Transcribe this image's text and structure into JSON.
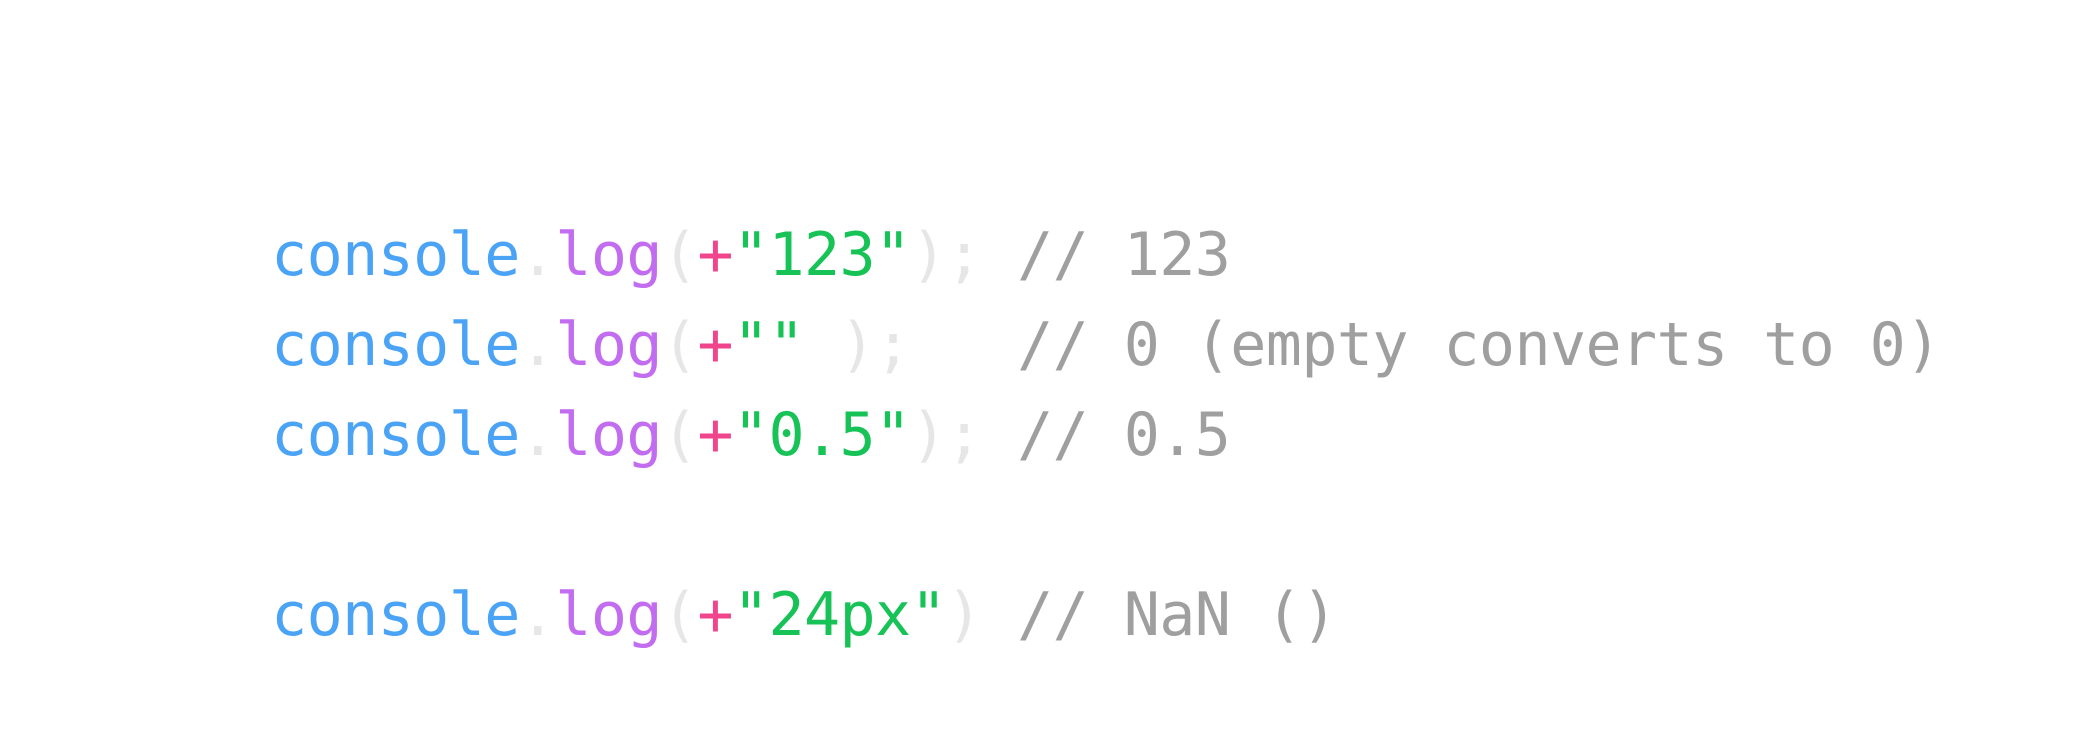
{
  "theme": {
    "background": "#ffffff",
    "object_color": "#4aa3f5",
    "method_color": "#c26cf0",
    "operator_color": "#f0458c",
    "string_color": "#17c257",
    "punctuation_color": "#e6e6e6",
    "comment_color": "#9f9f9f"
  },
  "lines": [
    {
      "tokens": [
        {
          "text": "console",
          "kind": "object"
        },
        {
          "text": ".",
          "kind": "punctuation"
        },
        {
          "text": "log",
          "kind": "method"
        },
        {
          "text": "(",
          "kind": "punctuation"
        },
        {
          "text": "+",
          "kind": "operator"
        },
        {
          "text": "\"123\"",
          "kind": "string"
        },
        {
          "text": ");",
          "kind": "punctuation"
        },
        {
          "text": " // 123",
          "kind": "comment"
        }
      ]
    },
    {
      "tokens": [
        {
          "text": "console",
          "kind": "object"
        },
        {
          "text": ".",
          "kind": "punctuation"
        },
        {
          "text": "log",
          "kind": "method"
        },
        {
          "text": "(",
          "kind": "punctuation"
        },
        {
          "text": "+",
          "kind": "operator"
        },
        {
          "text": "\"\"",
          "kind": "string"
        },
        {
          "text": " );",
          "kind": "punctuation"
        },
        {
          "text": "   // 0 (empty converts to 0)",
          "kind": "comment"
        }
      ]
    },
    {
      "tokens": [
        {
          "text": "console",
          "kind": "object"
        },
        {
          "text": ".",
          "kind": "punctuation"
        },
        {
          "text": "log",
          "kind": "method"
        },
        {
          "text": "(",
          "kind": "punctuation"
        },
        {
          "text": "+",
          "kind": "operator"
        },
        {
          "text": "\"0.5\"",
          "kind": "string"
        },
        {
          "text": ");",
          "kind": "punctuation"
        },
        {
          "text": " // 0.5",
          "kind": "comment"
        }
      ]
    },
    {
      "tokens": [
        {
          "text": "console",
          "kind": "object"
        },
        {
          "text": ".",
          "kind": "punctuation"
        },
        {
          "text": "log",
          "kind": "method"
        },
        {
          "text": "(",
          "kind": "punctuation"
        },
        {
          "text": "+",
          "kind": "operator"
        },
        {
          "text": "\"24px\"",
          "kind": "string"
        },
        {
          "text": ")",
          "kind": "punctuation"
        },
        {
          "text": " // NaN ()",
          "kind": "comment"
        }
      ]
    }
  ]
}
